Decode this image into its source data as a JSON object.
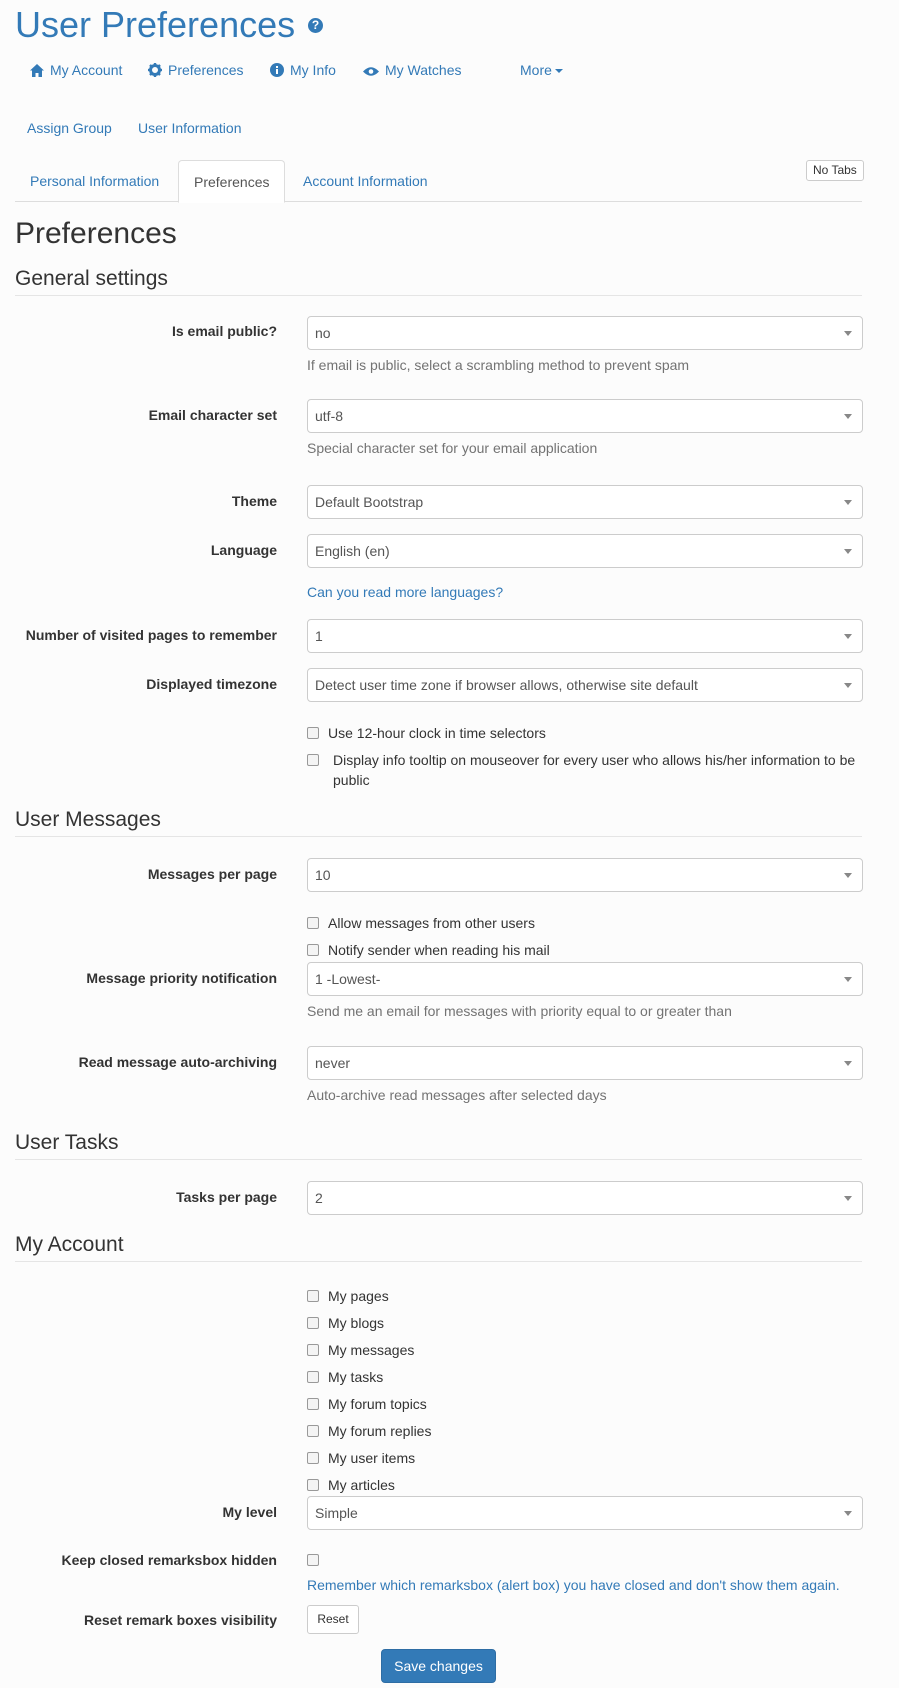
{
  "page": {
    "title": "User Preferences",
    "help_glyph": "?"
  },
  "topnav": {
    "my_account": "My Account",
    "preferences": "Preferences",
    "my_info": "My Info",
    "my_watches": "My Watches",
    "more": "More"
  },
  "subnav": {
    "assign_group": "Assign Group",
    "user_information": "User Information"
  },
  "tabs": {
    "personal": "Personal Information",
    "preferences": "Preferences",
    "account": "Account Information",
    "no_tabs": "No Tabs"
  },
  "heading": "Preferences",
  "general": {
    "title": "General settings",
    "email_public": {
      "label": "Is email public?",
      "value": "no",
      "help": "If email is public, select a scrambling method to prevent spam"
    },
    "email_charset": {
      "label": "Email character set",
      "value": "utf-8",
      "help": "Special character set for your email application"
    },
    "theme": {
      "label": "Theme",
      "value": "Default Bootstrap"
    },
    "language": {
      "label": "Language",
      "value": "English (en)",
      "link": "Can you read more languages?"
    },
    "visited_pages": {
      "label": "Number of visited pages to remember",
      "value": "1"
    },
    "timezone": {
      "label": "Displayed timezone",
      "value": "Detect user time zone if browser allows, otherwise site default"
    },
    "clock12": "Use 12-hour clock in time selectors",
    "tooltip": "Display info tooltip on mouseover for every user who allows his/her information to be public"
  },
  "messages": {
    "title": "User Messages",
    "per_page": {
      "label": "Messages per page",
      "value": "10"
    },
    "allow": "Allow messages from other users",
    "notify": "Notify sender when reading his mail",
    "priority": {
      "label": "Message priority notification",
      "value": "1 -Lowest-",
      "help": "Send me an email for messages with priority equal to or greater than"
    },
    "archiving": {
      "label": "Read message auto-archiving",
      "value": "never",
      "help": "Auto-archive read messages after selected days"
    }
  },
  "tasks": {
    "title": "User Tasks",
    "per_page": {
      "label": "Tasks per page",
      "value": "2"
    }
  },
  "account": {
    "title": "My Account",
    "items": [
      "My pages",
      "My blogs",
      "My messages",
      "My tasks",
      "My forum topics",
      "My forum replies",
      "My user items",
      "My articles"
    ],
    "level": {
      "label": "My level",
      "value": "Simple"
    },
    "remarks_hidden": {
      "label": "Keep closed remarksbox hidden",
      "help": "Remember which remarksbox (alert box) you have closed and don't show them again."
    },
    "reset": {
      "label": "Reset remark boxes visibility",
      "button": "Reset"
    }
  },
  "save_label": "Save changes",
  "colors": {
    "primary": "#337ab7",
    "text": "#333333",
    "muted": "#737373"
  }
}
